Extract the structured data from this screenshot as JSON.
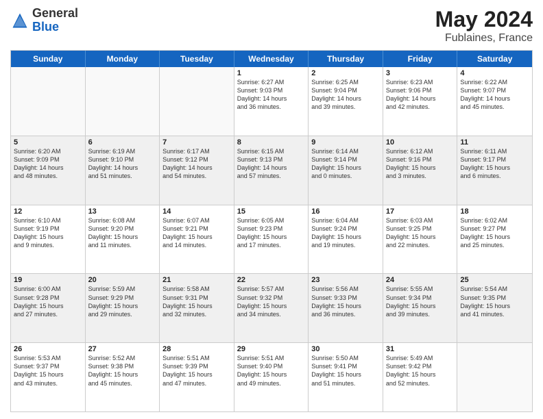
{
  "header": {
    "logo_general": "General",
    "logo_blue": "Blue",
    "title": "May 2024",
    "location": "Fublaines, France"
  },
  "weekdays": [
    "Sunday",
    "Monday",
    "Tuesday",
    "Wednesday",
    "Thursday",
    "Friday",
    "Saturday"
  ],
  "rows": [
    [
      {
        "day": "",
        "lines": [],
        "empty": true
      },
      {
        "day": "",
        "lines": [],
        "empty": true
      },
      {
        "day": "",
        "lines": [],
        "empty": true
      },
      {
        "day": "1",
        "lines": [
          "Sunrise: 6:27 AM",
          "Sunset: 9:03 PM",
          "Daylight: 14 hours",
          "and 36 minutes."
        ]
      },
      {
        "day": "2",
        "lines": [
          "Sunrise: 6:25 AM",
          "Sunset: 9:04 PM",
          "Daylight: 14 hours",
          "and 39 minutes."
        ]
      },
      {
        "day": "3",
        "lines": [
          "Sunrise: 6:23 AM",
          "Sunset: 9:06 PM",
          "Daylight: 14 hours",
          "and 42 minutes."
        ]
      },
      {
        "day": "4",
        "lines": [
          "Sunrise: 6:22 AM",
          "Sunset: 9:07 PM",
          "Daylight: 14 hours",
          "and 45 minutes."
        ]
      }
    ],
    [
      {
        "day": "5",
        "lines": [
          "Sunrise: 6:20 AM",
          "Sunset: 9:09 PM",
          "Daylight: 14 hours",
          "and 48 minutes."
        ],
        "shaded": true
      },
      {
        "day": "6",
        "lines": [
          "Sunrise: 6:19 AM",
          "Sunset: 9:10 PM",
          "Daylight: 14 hours",
          "and 51 minutes."
        ],
        "shaded": true
      },
      {
        "day": "7",
        "lines": [
          "Sunrise: 6:17 AM",
          "Sunset: 9:12 PM",
          "Daylight: 14 hours",
          "and 54 minutes."
        ],
        "shaded": true
      },
      {
        "day": "8",
        "lines": [
          "Sunrise: 6:15 AM",
          "Sunset: 9:13 PM",
          "Daylight: 14 hours",
          "and 57 minutes."
        ],
        "shaded": true
      },
      {
        "day": "9",
        "lines": [
          "Sunrise: 6:14 AM",
          "Sunset: 9:14 PM",
          "Daylight: 15 hours",
          "and 0 minutes."
        ],
        "shaded": true
      },
      {
        "day": "10",
        "lines": [
          "Sunrise: 6:12 AM",
          "Sunset: 9:16 PM",
          "Daylight: 15 hours",
          "and 3 minutes."
        ],
        "shaded": true
      },
      {
        "day": "11",
        "lines": [
          "Sunrise: 6:11 AM",
          "Sunset: 9:17 PM",
          "Daylight: 15 hours",
          "and 6 minutes."
        ],
        "shaded": true
      }
    ],
    [
      {
        "day": "12",
        "lines": [
          "Sunrise: 6:10 AM",
          "Sunset: 9:19 PM",
          "Daylight: 15 hours",
          "and 9 minutes."
        ]
      },
      {
        "day": "13",
        "lines": [
          "Sunrise: 6:08 AM",
          "Sunset: 9:20 PM",
          "Daylight: 15 hours",
          "and 11 minutes."
        ]
      },
      {
        "day": "14",
        "lines": [
          "Sunrise: 6:07 AM",
          "Sunset: 9:21 PM",
          "Daylight: 15 hours",
          "and 14 minutes."
        ]
      },
      {
        "day": "15",
        "lines": [
          "Sunrise: 6:05 AM",
          "Sunset: 9:23 PM",
          "Daylight: 15 hours",
          "and 17 minutes."
        ]
      },
      {
        "day": "16",
        "lines": [
          "Sunrise: 6:04 AM",
          "Sunset: 9:24 PM",
          "Daylight: 15 hours",
          "and 19 minutes."
        ]
      },
      {
        "day": "17",
        "lines": [
          "Sunrise: 6:03 AM",
          "Sunset: 9:25 PM",
          "Daylight: 15 hours",
          "and 22 minutes."
        ]
      },
      {
        "day": "18",
        "lines": [
          "Sunrise: 6:02 AM",
          "Sunset: 9:27 PM",
          "Daylight: 15 hours",
          "and 25 minutes."
        ]
      }
    ],
    [
      {
        "day": "19",
        "lines": [
          "Sunrise: 6:00 AM",
          "Sunset: 9:28 PM",
          "Daylight: 15 hours",
          "and 27 minutes."
        ],
        "shaded": true
      },
      {
        "day": "20",
        "lines": [
          "Sunrise: 5:59 AM",
          "Sunset: 9:29 PM",
          "Daylight: 15 hours",
          "and 29 minutes."
        ],
        "shaded": true
      },
      {
        "day": "21",
        "lines": [
          "Sunrise: 5:58 AM",
          "Sunset: 9:31 PM",
          "Daylight: 15 hours",
          "and 32 minutes."
        ],
        "shaded": true
      },
      {
        "day": "22",
        "lines": [
          "Sunrise: 5:57 AM",
          "Sunset: 9:32 PM",
          "Daylight: 15 hours",
          "and 34 minutes."
        ],
        "shaded": true
      },
      {
        "day": "23",
        "lines": [
          "Sunrise: 5:56 AM",
          "Sunset: 9:33 PM",
          "Daylight: 15 hours",
          "and 36 minutes."
        ],
        "shaded": true
      },
      {
        "day": "24",
        "lines": [
          "Sunrise: 5:55 AM",
          "Sunset: 9:34 PM",
          "Daylight: 15 hours",
          "and 39 minutes."
        ],
        "shaded": true
      },
      {
        "day": "25",
        "lines": [
          "Sunrise: 5:54 AM",
          "Sunset: 9:35 PM",
          "Daylight: 15 hours",
          "and 41 minutes."
        ],
        "shaded": true
      }
    ],
    [
      {
        "day": "26",
        "lines": [
          "Sunrise: 5:53 AM",
          "Sunset: 9:37 PM",
          "Daylight: 15 hours",
          "and 43 minutes."
        ]
      },
      {
        "day": "27",
        "lines": [
          "Sunrise: 5:52 AM",
          "Sunset: 9:38 PM",
          "Daylight: 15 hours",
          "and 45 minutes."
        ]
      },
      {
        "day": "28",
        "lines": [
          "Sunrise: 5:51 AM",
          "Sunset: 9:39 PM",
          "Daylight: 15 hours",
          "and 47 minutes."
        ]
      },
      {
        "day": "29",
        "lines": [
          "Sunrise: 5:51 AM",
          "Sunset: 9:40 PM",
          "Daylight: 15 hours",
          "and 49 minutes."
        ]
      },
      {
        "day": "30",
        "lines": [
          "Sunrise: 5:50 AM",
          "Sunset: 9:41 PM",
          "Daylight: 15 hours",
          "and 51 minutes."
        ]
      },
      {
        "day": "31",
        "lines": [
          "Sunrise: 5:49 AM",
          "Sunset: 9:42 PM",
          "Daylight: 15 hours",
          "and 52 minutes."
        ]
      },
      {
        "day": "",
        "lines": [],
        "empty": true
      }
    ]
  ]
}
